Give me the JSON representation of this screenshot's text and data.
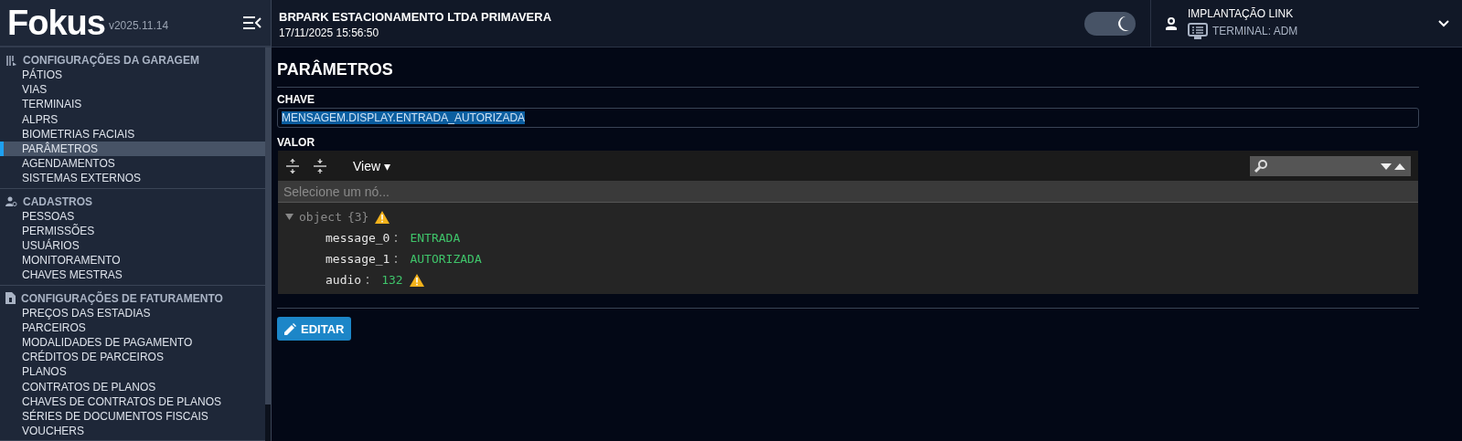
{
  "logo": {
    "text": "Fokus",
    "version": "v2025.11.14"
  },
  "header": {
    "company": "BRPARK ESTACIONAMENTO LTDA PRIMAVERA",
    "datetime": "17/11/2025 15:56:50",
    "dark_mode": true,
    "user": "IMPLANTAÇÃO LINK",
    "terminal": "TERMINAL: ADM"
  },
  "sidebar": {
    "sections": [
      {
        "title": "CONFIGURAÇÕES DA GARAGEM",
        "kind": "garage",
        "items": [
          {
            "label": "PÁTIOS",
            "selected": false
          },
          {
            "label": "VIAS",
            "selected": false
          },
          {
            "label": "TERMINAIS",
            "selected": false
          },
          {
            "label": "ALPRS",
            "selected": false
          },
          {
            "label": "BIOMETRIAS FACIAIS",
            "selected": false
          },
          {
            "label": "PARÂMETROS",
            "selected": true
          },
          {
            "label": "AGENDAMENTOS",
            "selected": false
          },
          {
            "label": "SISTEMAS EXTERNOS",
            "selected": false
          }
        ]
      },
      {
        "title": "CADASTROS",
        "kind": "people",
        "items": [
          {
            "label": "PESSOAS",
            "selected": false
          },
          {
            "label": "PERMISSÕES",
            "selected": false
          },
          {
            "label": "USUÁRIOS",
            "selected": false
          },
          {
            "label": "MONITORAMENTO",
            "selected": false
          },
          {
            "label": "CHAVES MESTRAS",
            "selected": false
          }
        ]
      },
      {
        "title": "CONFIGURAÇÕES DE FATURAMENTO",
        "kind": "billing",
        "items": [
          {
            "label": "PREÇOS DAS ESTADIAS",
            "selected": false
          },
          {
            "label": "PARCEIROS",
            "selected": false
          },
          {
            "label": "MODALIDADES DE PAGAMENTO",
            "selected": false
          },
          {
            "label": "CRÉDITOS DE PARCEIROS",
            "selected": false
          },
          {
            "label": "PLANOS",
            "selected": false
          },
          {
            "label": "CONTRATOS DE PLANOS",
            "selected": false
          },
          {
            "label": "CHAVES DE CONTRATOS DE PLANOS",
            "selected": false
          },
          {
            "label": "SÉRIES DE DOCUMENTOS FISCAIS",
            "selected": false
          },
          {
            "label": "VOUCHERS",
            "selected": false
          }
        ]
      }
    ]
  },
  "page": {
    "title": "PARÂMETROS",
    "key_label": "CHAVE",
    "key_value": "MENSAGEM.DISPLAY.ENTRADA_AUTORIZADA",
    "value_label": "VALOR",
    "editor": {
      "view_menu": "View ▾",
      "search_placeholder": "Selecione um nó...",
      "root": {
        "type": "object",
        "count": "{3}",
        "expanded": true,
        "warning": true
      },
      "fields": [
        {
          "key": "message_0",
          "value": "ENTRADA",
          "warning": false
        },
        {
          "key": "message_1",
          "value": "AUTORIZADA",
          "warning": false
        },
        {
          "key": "audio",
          "value": "132",
          "warning": true
        }
      ]
    },
    "edit_button": "EDITAR"
  }
}
